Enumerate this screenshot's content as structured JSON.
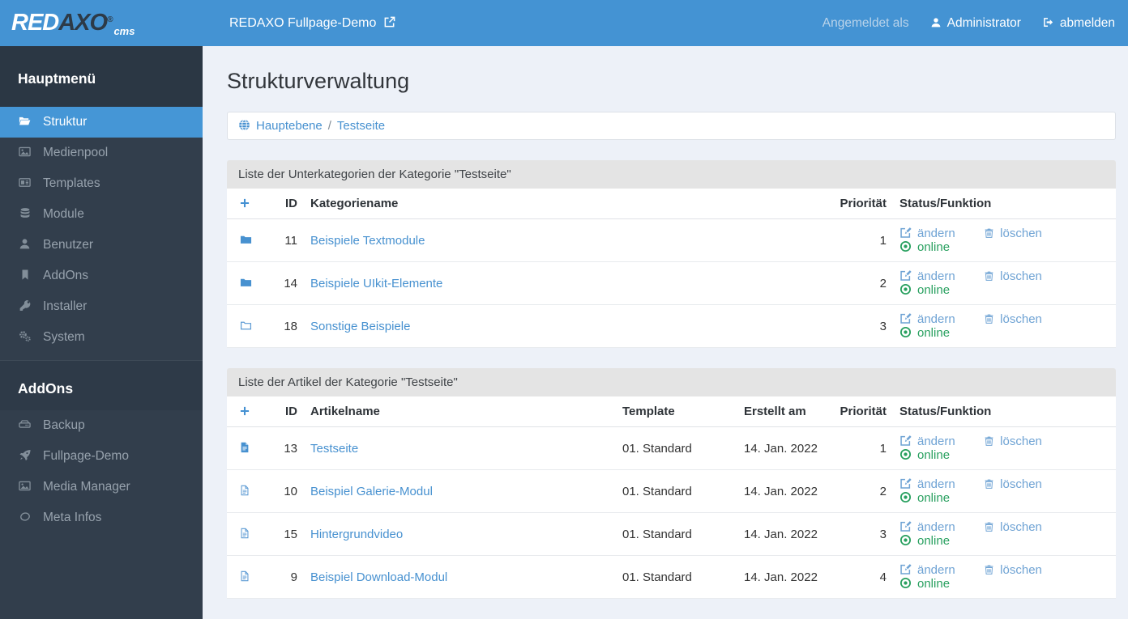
{
  "colors": {
    "header_blue": "#4493d3",
    "sidebar_bg": "#323e4c",
    "active_item_blue": "#4596d6",
    "link_blue": "#4791d0",
    "action_link_blue": "#6fa3d4",
    "online_green": "#28a05f",
    "main_bg": "#edf1f8",
    "panel_heading_bg": "#e4e4e4"
  },
  "header": {
    "logo": {
      "red": "RED",
      "axo": "AXO",
      "reg": "®",
      "cms": "cms"
    },
    "site_link": "REDAXO Fullpage-Demo",
    "logged_in_as": "Angemeldet als",
    "user": "Administrator",
    "logout": "abmelden"
  },
  "sidebar": {
    "main": {
      "title": "Hauptmenü",
      "items": [
        {
          "icon": "folder-open-icon",
          "label": "Struktur",
          "active": true
        },
        {
          "icon": "image-icon",
          "label": "Medienpool",
          "active": false
        },
        {
          "icon": "newspaper-icon",
          "label": "Templates",
          "active": false
        },
        {
          "icon": "database-icon",
          "label": "Module",
          "active": false
        },
        {
          "icon": "user-icon",
          "label": "Benutzer",
          "active": false
        },
        {
          "icon": "bookmark-icon",
          "label": "AddOns",
          "active": false
        },
        {
          "icon": "key-icon",
          "label": "Installer",
          "active": false
        },
        {
          "icon": "cogs-icon",
          "label": "System",
          "active": false
        }
      ]
    },
    "addons": {
      "title": "AddOns",
      "items": [
        {
          "icon": "hdd-icon",
          "label": "Backup",
          "active": false
        },
        {
          "icon": "rocket-icon",
          "label": "Fullpage-Demo",
          "active": false
        },
        {
          "icon": "image-icon",
          "label": "Media Manager",
          "active": false
        },
        {
          "icon": "comment-outline-icon",
          "label": "Meta Infos",
          "active": false
        }
      ]
    }
  },
  "page": {
    "title": "Strukturverwaltung",
    "breadcrumb": {
      "icon": "globe-icon",
      "root": "Hauptebene",
      "separator": "/",
      "current": "Testseite"
    }
  },
  "categories_panel": {
    "title": "Liste der Unterkategorien der Kategorie \"Testseite\"",
    "columns": {
      "add": "+",
      "id": "ID",
      "name": "Kategoriename",
      "priority": "Priorität",
      "status": "Status/Funktion"
    },
    "rows": [
      {
        "icon": "folder-solid-icon",
        "id": "11",
        "name": "Beispiele Textmodule",
        "priority": "1",
        "edit": "ändern",
        "delete": "löschen",
        "status": "online"
      },
      {
        "icon": "folder-solid-icon",
        "id": "14",
        "name": "Beispiele UIkit-Elemente",
        "priority": "2",
        "edit": "ändern",
        "delete": "löschen",
        "status": "online"
      },
      {
        "icon": "folder-outline-icon",
        "id": "18",
        "name": "Sonstige Beispiele",
        "priority": "3",
        "edit": "ändern",
        "delete": "löschen",
        "status": "online"
      }
    ]
  },
  "articles_panel": {
    "title": "Liste der Artikel der Kategorie \"Testseite\"",
    "columns": {
      "add": "+",
      "id": "ID",
      "name": "Artikelname",
      "template": "Template",
      "created": "Erstellt am",
      "priority": "Priorität",
      "status": "Status/Funktion"
    },
    "rows": [
      {
        "icon": "file-solid-icon",
        "id": "13",
        "name": "Testseite",
        "template": "01. Standard",
        "created": "14. Jan. 2022",
        "priority": "1",
        "edit": "ändern",
        "delete": "löschen",
        "status": "online"
      },
      {
        "icon": "file-outline-icon",
        "id": "10",
        "name": "Beispiel Galerie-Modul",
        "template": "01. Standard",
        "created": "14. Jan. 2022",
        "priority": "2",
        "edit": "ändern",
        "delete": "löschen",
        "status": "online"
      },
      {
        "icon": "file-outline-icon",
        "id": "15",
        "name": "Hintergrundvideo",
        "template": "01. Standard",
        "created": "14. Jan. 2022",
        "priority": "3",
        "edit": "ändern",
        "delete": "löschen",
        "status": "online"
      },
      {
        "icon": "file-outline-icon",
        "id": "9",
        "name": "Beispiel Download-Modul",
        "template": "01. Standard",
        "created": "14. Jan. 2022",
        "priority": "4",
        "edit": "ändern",
        "delete": "löschen",
        "status": "online"
      }
    ]
  }
}
